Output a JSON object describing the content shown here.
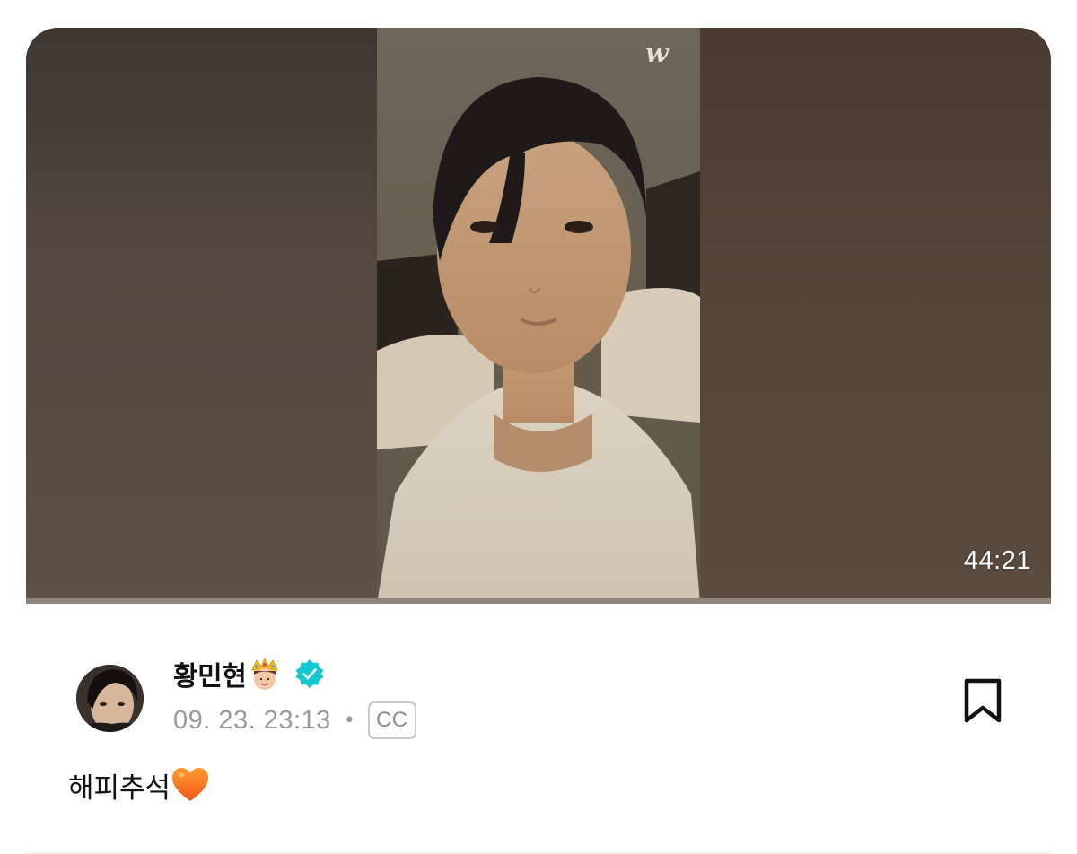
{
  "video": {
    "watermark": "w",
    "duration": "44:21",
    "progress": 0
  },
  "post": {
    "author_name": "황민현",
    "date": "09. 23. 23:13",
    "separator": "•",
    "cc_label": "CC",
    "text": "해피추석"
  },
  "colors": {
    "verified": "#13c7d3",
    "cc_border": "#c9c9cc",
    "date_text": "#9a9a9e",
    "heart": "#ff7a1e"
  },
  "icons": {
    "author_emoji": "crown-prince-emoji",
    "verified": "verified-badge-icon",
    "bookmark": "bookmark-icon",
    "heart": "orange-heart-emoji"
  }
}
